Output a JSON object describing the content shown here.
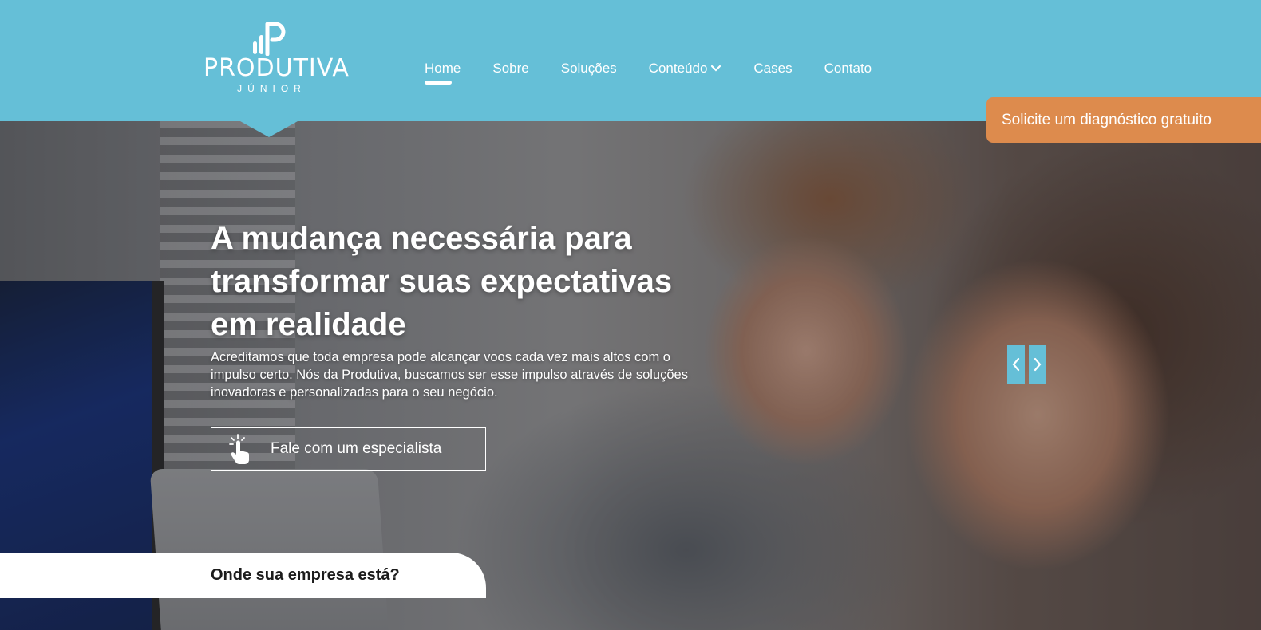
{
  "header": {
    "logo": {
      "name": "PRODUTIVA",
      "subtitle": "JÚNIOR"
    },
    "nav": [
      {
        "label": "Home",
        "active": true
      },
      {
        "label": "Sobre"
      },
      {
        "label": "Soluções"
      },
      {
        "label": "Conteúdo",
        "has_dropdown": true
      },
      {
        "label": "Cases"
      },
      {
        "label": "Contato"
      }
    ],
    "cta": "Solicite um diagnóstico gratuito"
  },
  "hero": {
    "title": "A mudança necessária para transformar suas expectativas em realidade",
    "description": "Acreditamos que toda empresa pode alcançar voos cada vez mais altos com o impulso certo. Nós da Produtiva, buscamos ser esse impulso através de soluções inovadoras e personalizadas para o seu negócio.",
    "button": {
      "label": "Fale com um especialista",
      "icon": "hand-pointer-icon"
    },
    "slider": {
      "prev_icon": "chevron-left-icon",
      "next_icon": "chevron-right-icon"
    }
  },
  "section_tab": {
    "label": "Onde sua empresa está?"
  },
  "colors": {
    "header_bg": "#65bfd7",
    "cta_bg": "#dd8b4d",
    "text_light": "#ffffff",
    "text_dark": "#1c1c1c"
  }
}
